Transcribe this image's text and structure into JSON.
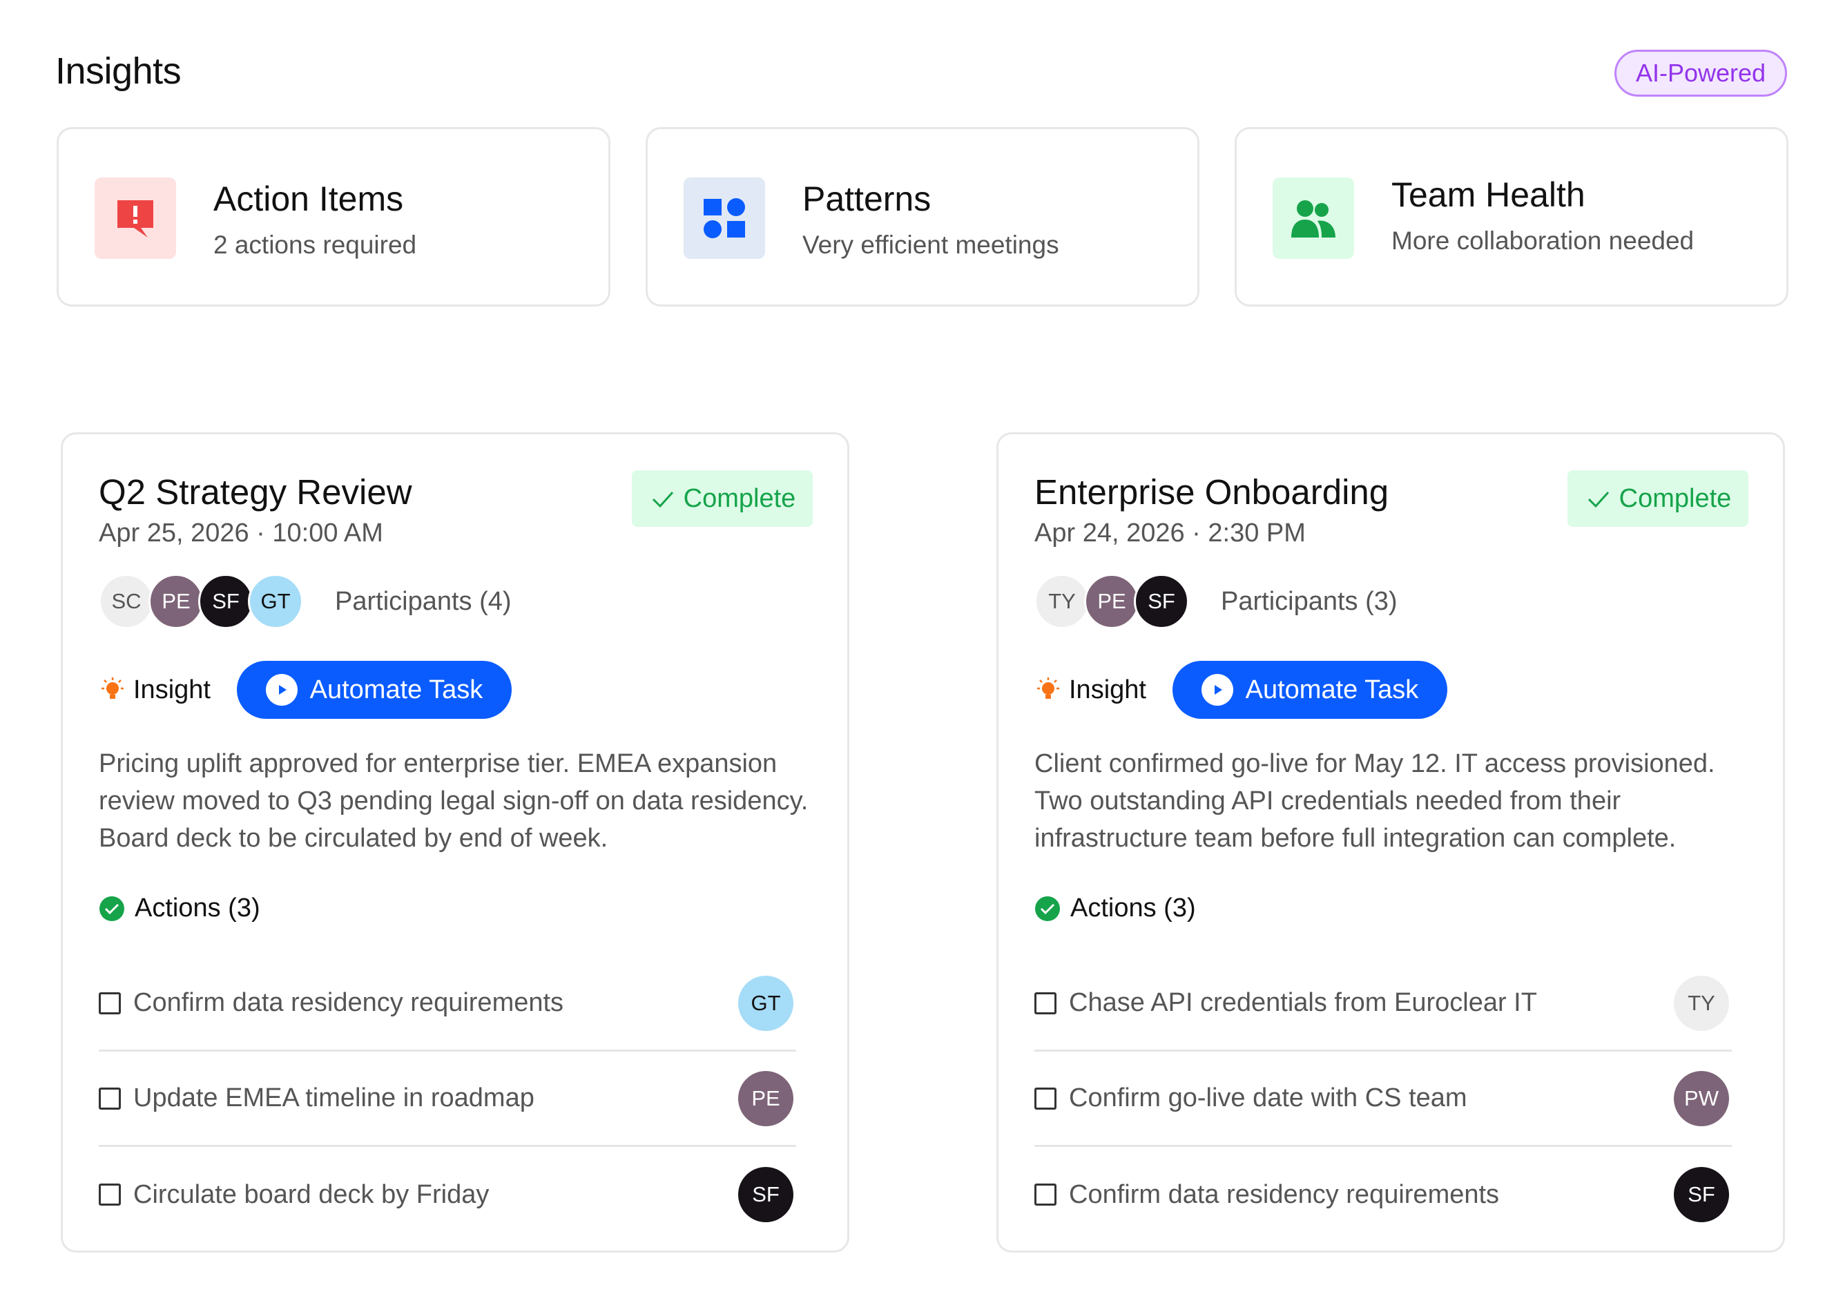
{
  "header": {
    "title": "Insights",
    "badge": "AI-Powered"
  },
  "summary_cards": [
    {
      "title": "Action Items",
      "subtitle": "2 actions required",
      "icon": "alert-message-icon",
      "icon_color": "#ef4444",
      "icon_bg": "#fee2e2"
    },
    {
      "title": "Patterns",
      "subtitle": "Very efficient meetings",
      "icon": "shapes-icon",
      "icon_color": "#0b5cff",
      "icon_bg": "#e0e9f5"
    },
    {
      "title": "Team Health",
      "subtitle": "More collaboration needed",
      "icon": "people-icon",
      "icon_color": "#16a34a",
      "icon_bg": "#dcfce7"
    }
  ],
  "meetings": [
    {
      "title": "Q2 Strategy Review",
      "date": "Apr 25, 2026 · 10:00 AM",
      "status": "Complete",
      "participants": [
        {
          "initials": "SC",
          "bg": "#eeeeee",
          "fg": "#555555"
        },
        {
          "initials": "PE",
          "bg": "#7d6478",
          "fg": "#ffffff"
        },
        {
          "initials": "SF",
          "bg": "#161218",
          "fg": "#ffffff"
        },
        {
          "initials": "GT",
          "bg": "#a5dcf7",
          "fg": "#111111"
        }
      ],
      "participants_label": "Participants (4)",
      "insight_label": "Insight",
      "automate_label": "Automate Task",
      "summary": "Pricing uplift approved for enterprise tier. EMEA expansion review moved to Q3 pending legal sign-off on data residency. Board deck to be circulated by end of week.",
      "actions_label": "Actions (3)",
      "actions": [
        {
          "text": "Confirm data residency requirements",
          "initials": "GT",
          "bg": "#a5dcf7",
          "fg": "#111111"
        },
        {
          "text": "Update EMEA timeline in roadmap",
          "initials": "PE",
          "bg": "#7d6478",
          "fg": "#ffffff"
        },
        {
          "text": "Circulate board deck by Friday",
          "initials": "SF",
          "bg": "#161218",
          "fg": "#ffffff"
        }
      ]
    },
    {
      "title": "Enterprise Onboarding",
      "date": "Apr 24, 2026 · 2:30 PM",
      "status": "Complete",
      "participants": [
        {
          "initials": "TY",
          "bg": "#eeeeee",
          "fg": "#555555"
        },
        {
          "initials": "PE",
          "bg": "#7d6478",
          "fg": "#ffffff"
        },
        {
          "initials": "SF",
          "bg": "#161218",
          "fg": "#ffffff"
        }
      ],
      "participants_label": "Participants (3)",
      "insight_label": "Insight",
      "automate_label": "Automate Task",
      "summary": "Client confirmed go-live for May 12. IT access provisioned. Two outstanding API credentials needed from their infrastructure team before full integration can complete.",
      "actions_label": "Actions (3)",
      "actions": [
        {
          "text": "Chase API credentials from Euroclear IT",
          "initials": "TY",
          "bg": "#eeeeee",
          "fg": "#555555"
        },
        {
          "text": "Confirm go-live date with CS team",
          "initials": "PW",
          "bg": "#7d6478",
          "fg": "#ffffff"
        },
        {
          "text": "Confirm data residency requirements",
          "initials": "SF",
          "bg": "#161218",
          "fg": "#ffffff"
        }
      ]
    }
  ]
}
